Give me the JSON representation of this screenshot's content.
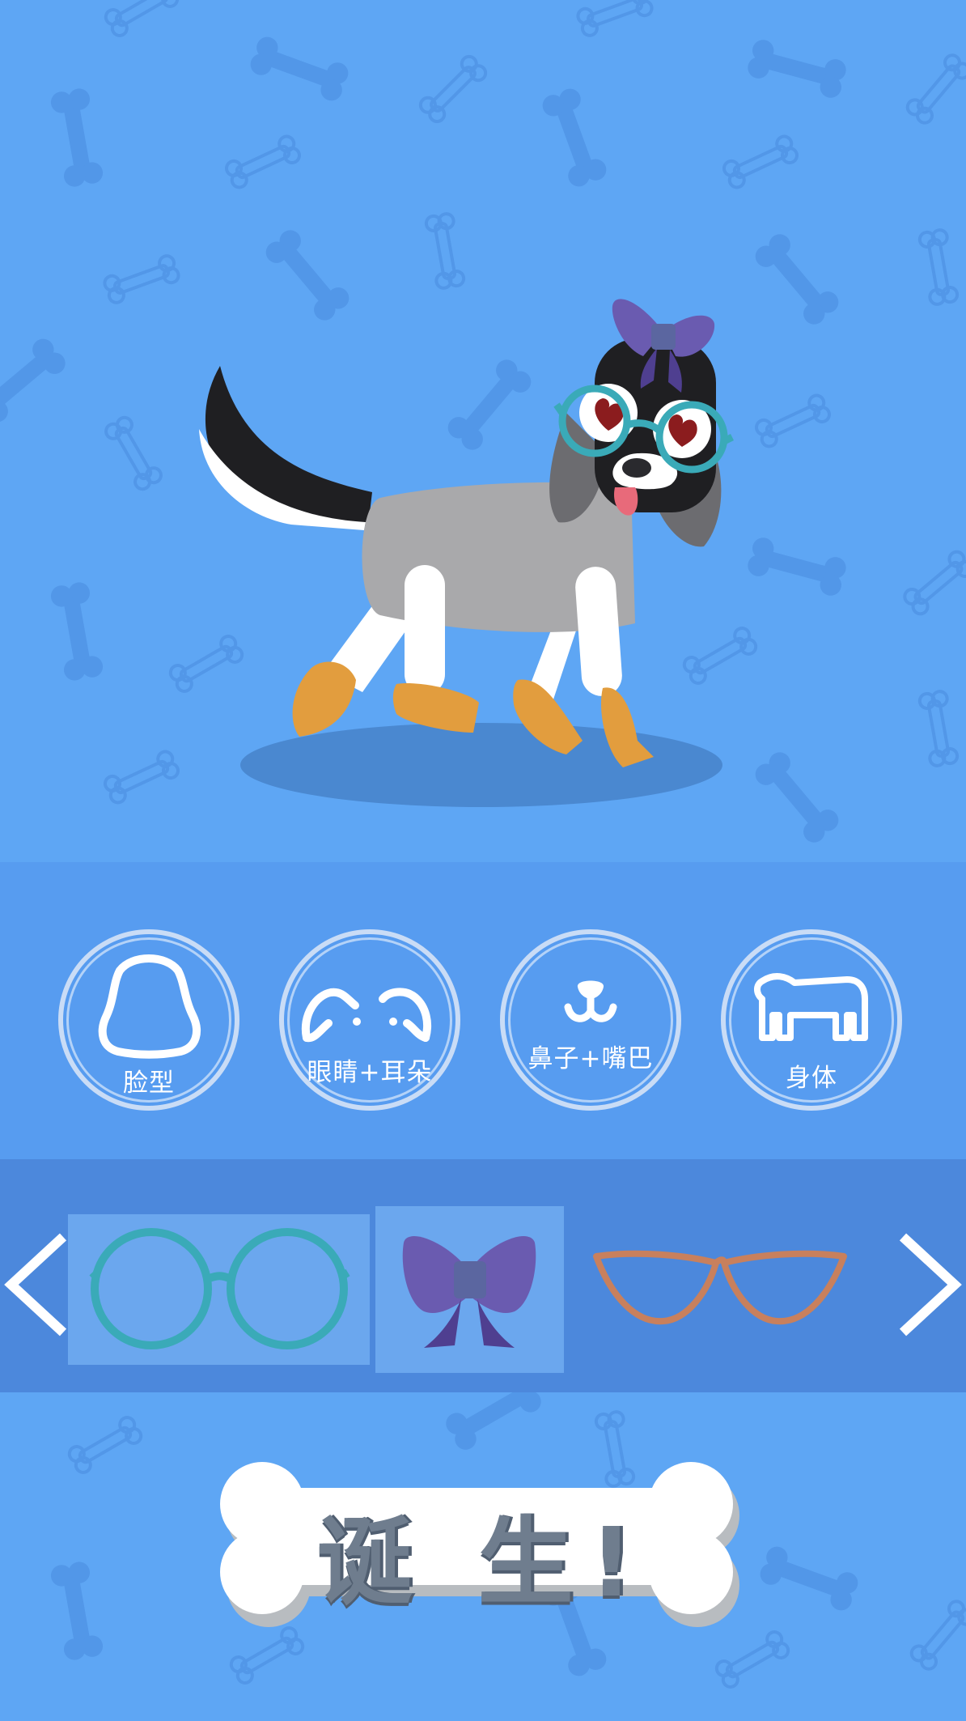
{
  "colors": {
    "background": "#5ea6f4",
    "category_panel": "#579cf0",
    "item_panel": "#4c88dc",
    "selected_slot": "#6ba7ee",
    "dog_body": "#a9a9ab",
    "dog_legs": "#ffffff",
    "dog_paws": "#e29d3e",
    "bow": "#6a5bb0",
    "glasses_round": "#3aaab8",
    "glasses_cat_eye": "#c8805d"
  },
  "categories": [
    {
      "label": "脸型",
      "icon": "face-shape-icon"
    },
    {
      "label": "眼睛+耳朵",
      "icon": "eyes-ears-icon"
    },
    {
      "label": "鼻子+嘴巴",
      "icon": "nose-mouth-icon"
    },
    {
      "label": "身体",
      "icon": "body-icon"
    }
  ],
  "items": [
    {
      "icon": "round-glasses-icon",
      "selected": true
    },
    {
      "icon": "purple-bow-icon",
      "selected": true
    },
    {
      "icon": "cat-eye-glasses-icon",
      "selected": false
    }
  ],
  "nav": {
    "prev_icon": "chevron-left-icon",
    "next_icon": "chevron-right-icon"
  },
  "birth_button": {
    "label": "诞 生!"
  }
}
